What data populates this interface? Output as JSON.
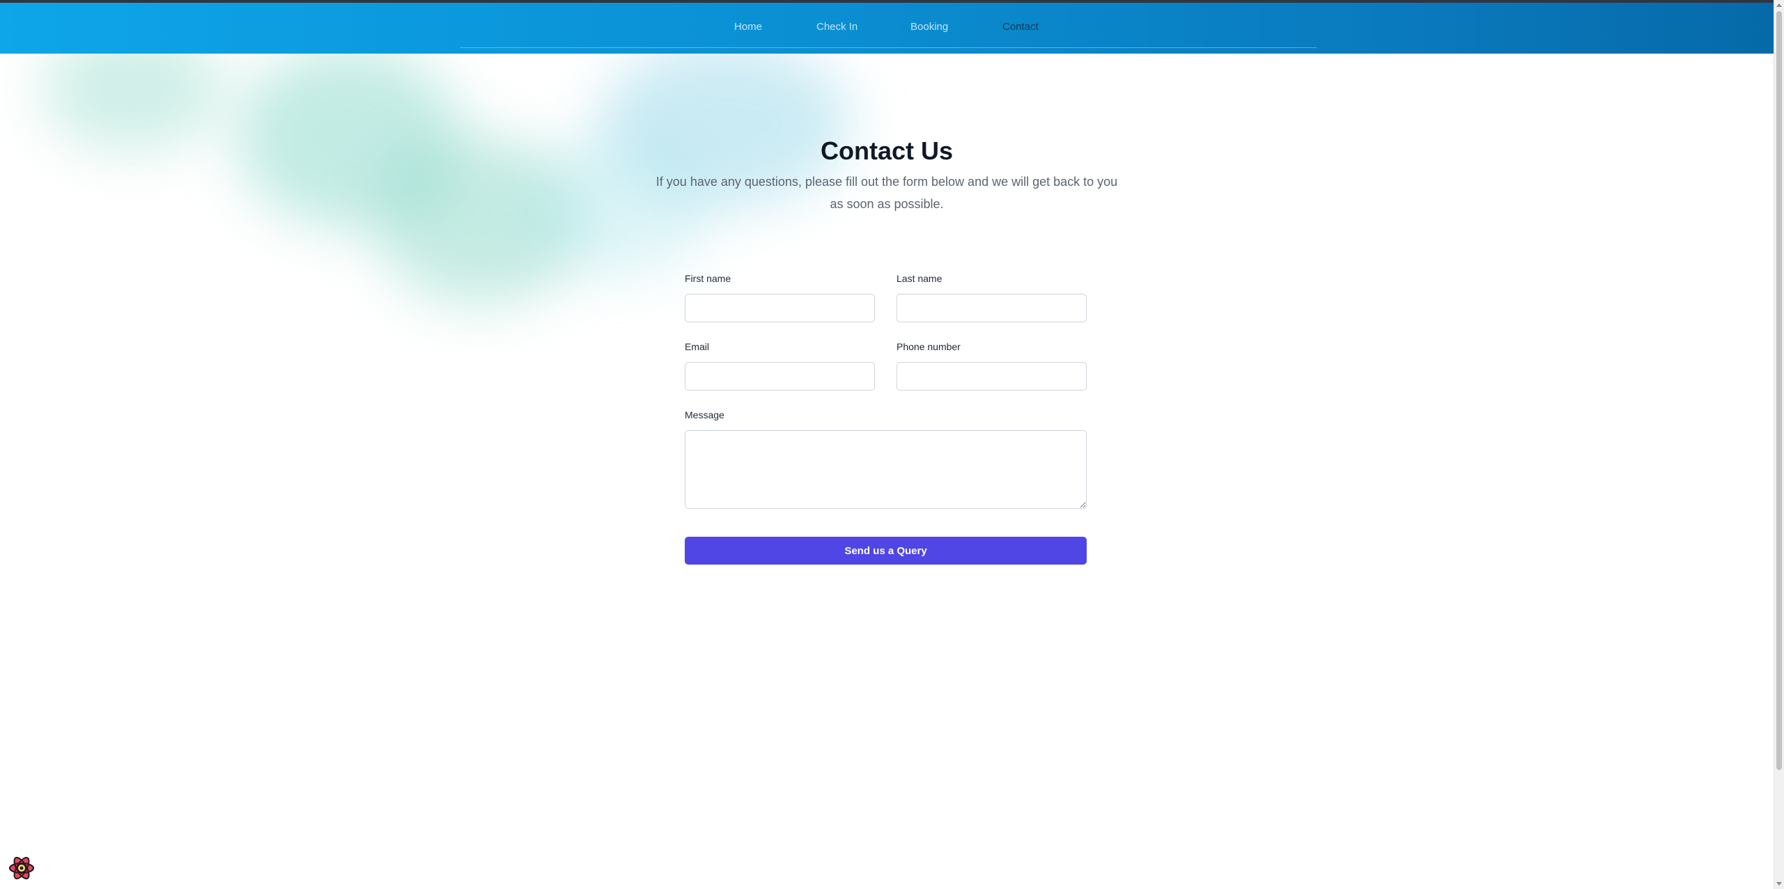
{
  "nav": {
    "links": [
      {
        "label": "Home",
        "active": false
      },
      {
        "label": "Check In",
        "active": false
      },
      {
        "label": "Booking",
        "active": false
      },
      {
        "label": "Contact",
        "active": true
      }
    ]
  },
  "header": {
    "title": "Contact Us",
    "subtitle": "If you have any questions, please fill out the form below and we will get back to you as soon as possible."
  },
  "form": {
    "first_name": {
      "label": "First name",
      "value": "",
      "placeholder": ""
    },
    "last_name": {
      "label": "Last name",
      "value": "",
      "placeholder": ""
    },
    "email": {
      "label": "Email",
      "value": "",
      "placeholder": ""
    },
    "phone": {
      "label": "Phone number",
      "value": "",
      "placeholder": ""
    },
    "message": {
      "label": "Message",
      "value": "",
      "placeholder": ""
    },
    "submit_label": "Send us a Query"
  },
  "colors": {
    "nav_gradient_start": "#0ea5e9",
    "nav_gradient_end": "#066aa8",
    "primary_button": "#4f46e5",
    "title_text": "#111827",
    "subtitle_text": "#5b6472"
  },
  "icons": {
    "devtools": "react-atom-icon"
  }
}
